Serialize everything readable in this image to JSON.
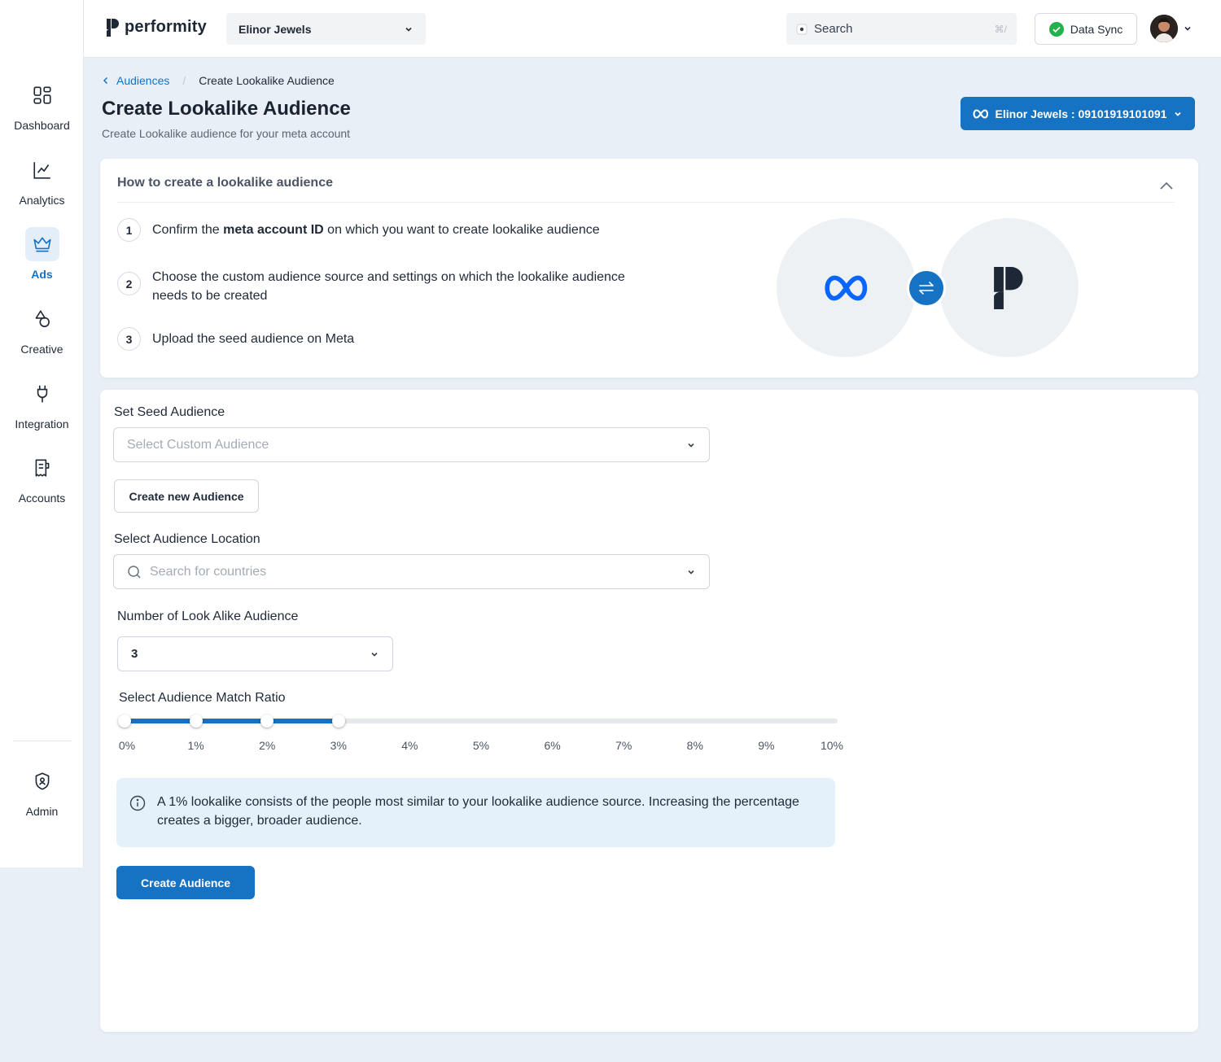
{
  "app": {
    "logo_text": "performity"
  },
  "sidebar": {
    "items": [
      {
        "id": "dashboard",
        "label": "Dashboard",
        "icon": "dashboard-icon"
      },
      {
        "id": "analytics",
        "label": "Analytics",
        "icon": "line-chart-icon"
      },
      {
        "id": "ads",
        "label": "Ads",
        "icon": "crown-icon",
        "active": true
      },
      {
        "id": "creative",
        "label": "Creative",
        "icon": "shapes-icon"
      },
      {
        "id": "integration",
        "label": "Integration",
        "icon": "plug-icon"
      },
      {
        "id": "accounts",
        "label": "Accounts",
        "icon": "receipt-icon"
      }
    ],
    "admin": {
      "label": "Admin",
      "icon": "shield-user-icon"
    }
  },
  "header": {
    "account_select": "Elinor Jewels",
    "search_placeholder": "Search",
    "search_shortcut": "⌘/",
    "data_sync_label": "Data Sync"
  },
  "page": {
    "breadcrumb": {
      "parent": "Audiences",
      "current": "Create Lookalike Audience"
    },
    "title": "Create Lookalike Audience",
    "subtitle": "Create Lookalike audience for your meta account",
    "meta_account_button": "Elinor Jewels : 09101919101091"
  },
  "howto": {
    "title": "How to create a lookalike audience",
    "steps": [
      {
        "num": "1",
        "pre": "Confirm the ",
        "bold": "meta account ID",
        "post": " on which you want to create lookalike audience"
      },
      {
        "num": "2",
        "text": "Choose the custom audience source and settings on which the lookalike audience needs to be created"
      },
      {
        "num": "3",
        "text": "Upload the seed audience on Meta"
      }
    ]
  },
  "form": {
    "seed_label": "Set Seed Audience",
    "seed_placeholder": "Select Custom Audience",
    "create_new_button": "Create new Audience",
    "location_label": "Select Audience Location",
    "location_placeholder": "Search for countries",
    "count_label": "Number of Look Alike Audience",
    "count_value": "3",
    "ratio_label": "Select Audience Match Ratio",
    "ratio_ticks": [
      "0%",
      "1%",
      "2%",
      "3%",
      "4%",
      "5%",
      "6%",
      "7%",
      "8%",
      "9%",
      "10%"
    ],
    "ratio_selected": [
      0,
      1,
      2,
      3
    ],
    "ratio_max": 10,
    "info_text": "A 1% lookalike consists of the people most similar to your lookalike audience source. Increasing the percentage creates a bigger, broader audience.",
    "submit_button": "Create Audience"
  },
  "colors": {
    "primary": "#1672c2",
    "meta_blue": "#0866ff",
    "sync_green": "#22b14c",
    "page_bg": "#e8eff6"
  }
}
